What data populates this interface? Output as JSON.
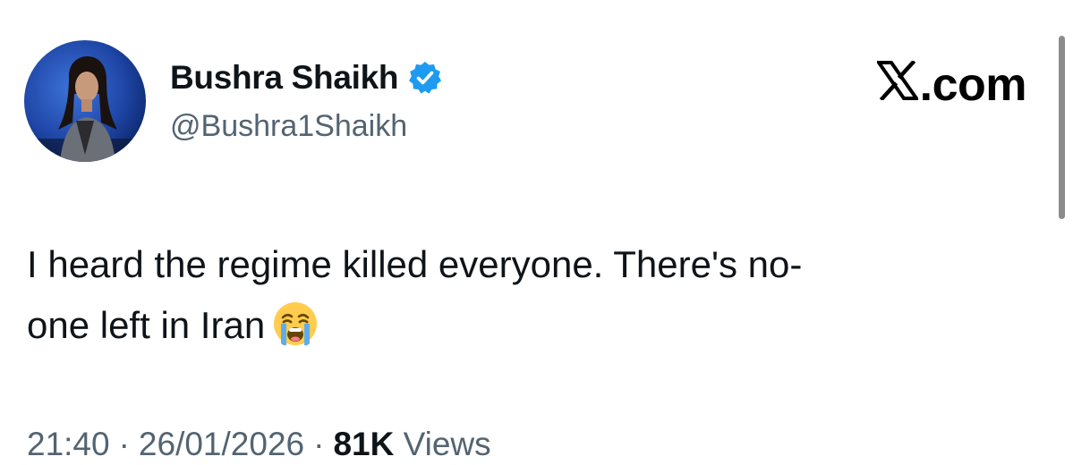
{
  "author": {
    "display_name": "Bushra Shaikh",
    "handle": "@Bushra1Shaikh",
    "verified": true,
    "avatar_icon": "profile-photo-avatar"
  },
  "brand": {
    "label": ".com",
    "logo_icon": "x-logo-icon"
  },
  "tweet": {
    "line1": "I heard the regime killed everyone. There's no-",
    "line2": "one left in Iran",
    "emoji": "loudly-crying-face-emoji"
  },
  "meta": {
    "time": "21:40",
    "separator": "·",
    "date": "26/01/2026",
    "views_count": "81K",
    "views_label": "Views"
  },
  "colors": {
    "verified_blue": "#1d9bf0",
    "secondary_text": "#536471",
    "primary_text": "#0f1419",
    "avatar_bg": "#1f47a8"
  }
}
